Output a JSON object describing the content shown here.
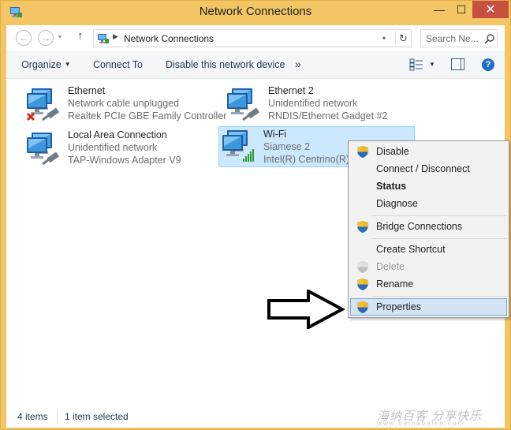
{
  "window": {
    "title": "Network Connections",
    "min_glyph": "—",
    "max_glyph": "☐",
    "close_glyph": "✕"
  },
  "address": {
    "path": "Network Connections",
    "separator": "▶",
    "back_glyph": "←",
    "forward_glyph": "→",
    "recent_glyph": "▾",
    "up_glyph": "↑",
    "dropdown_glyph": "▾",
    "refresh_glyph": "↻"
  },
  "search": {
    "placeholder": "Search Ne..."
  },
  "toolbar": {
    "organize_label": "Organize",
    "organize_caret": "▼",
    "connect_label": "Connect To",
    "disable_label": "Disable this network device",
    "more_label": "»",
    "view_dd": "▼",
    "help_label": "?"
  },
  "connections": [
    {
      "name": "Ethernet",
      "status": "Network cable unplugged",
      "device": "Realtek PCIe GBE Family Controller",
      "icon": "ethernet-disconnected-icon"
    },
    {
      "name": "Ethernet 2",
      "status": "Unidentified network",
      "device": "RNDIS/Ethernet Gadget #2",
      "icon": "ethernet-icon"
    },
    {
      "name": "Local Area Connection",
      "status": "Unidentified network",
      "device": "TAP-Windows Adapter V9",
      "icon": "ethernet-icon"
    },
    {
      "name": "Wi-Fi",
      "status": "Siamese  2",
      "device": "Intel(R) Centrino(R) A",
      "icon": "wifi-adapter-icon",
      "selected": true
    }
  ],
  "context_menu": {
    "items": [
      {
        "label": "Disable",
        "shield": true
      },
      {
        "label": "Connect / Disconnect",
        "shield": false
      },
      {
        "label": "Status",
        "shield": false,
        "bold": true
      },
      {
        "label": "Diagnose",
        "shield": false
      },
      {
        "label": "Bridge Connections",
        "shield": true
      },
      {
        "label": "Create Shortcut",
        "shield": false
      },
      {
        "label": "Delete",
        "shield": true,
        "disabled": true
      },
      {
        "label": "Rename",
        "shield": true
      },
      {
        "label": "Properties",
        "shield": true,
        "highlighted": true
      }
    ]
  },
  "statusbar": {
    "item_count": "4 items",
    "selected": "1 item selected"
  },
  "watermark": {
    "text": "海纳百客 分享快乐",
    "url": "www.hainabaike.com"
  },
  "colors": {
    "frame": "#f3c564",
    "selection": "#cce8ff",
    "menu_highlight": "#d5e4f3",
    "close_button": "#c7503f",
    "link_text": "#1e395b"
  }
}
